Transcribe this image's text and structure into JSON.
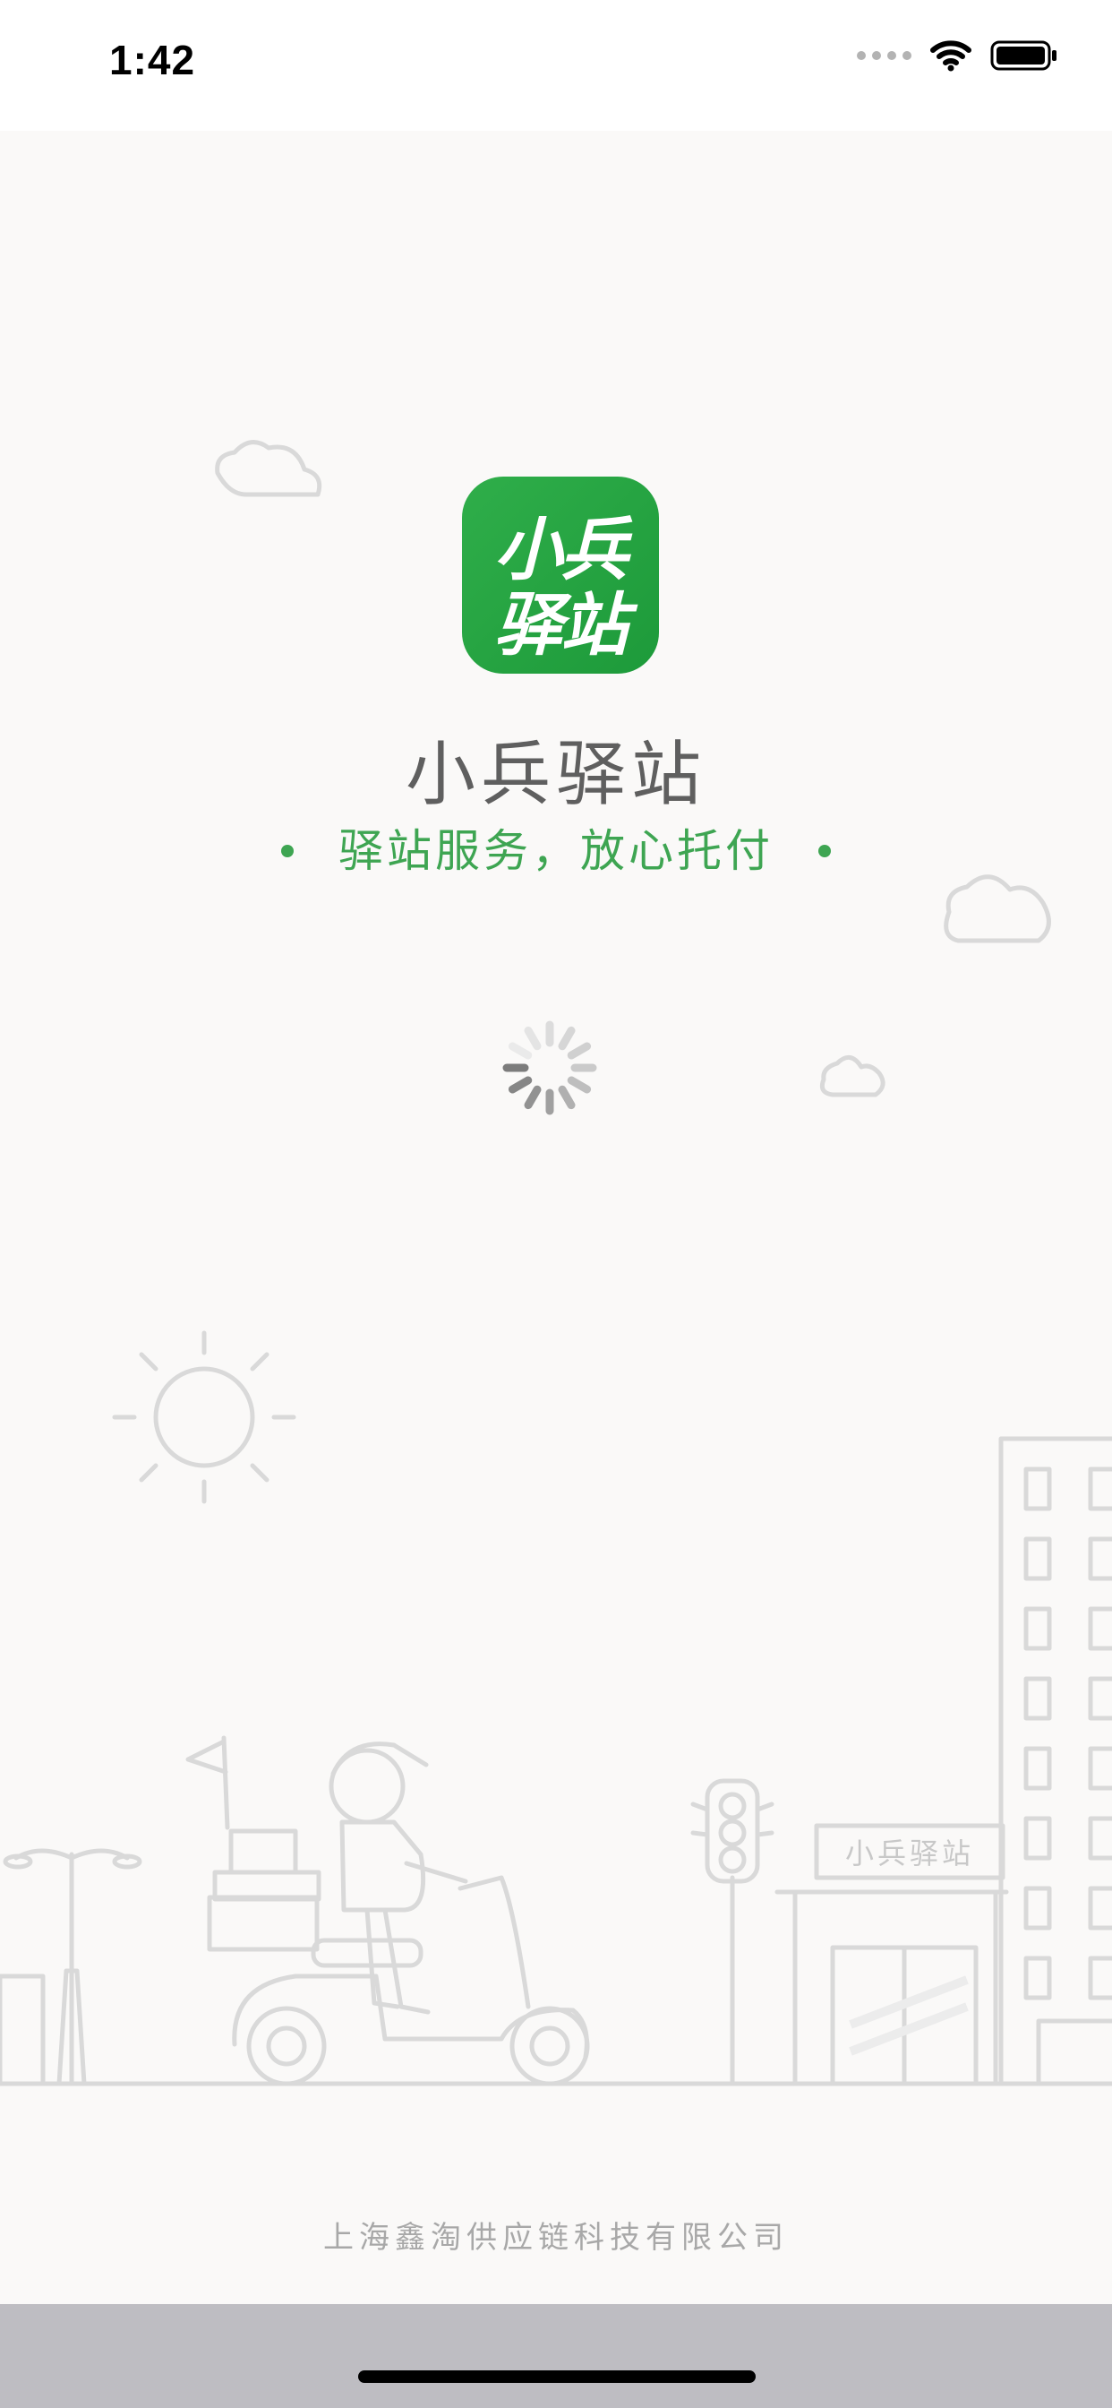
{
  "status_bar": {
    "time": "1:42",
    "icons": [
      "signal-dots-icon",
      "wifi-icon",
      "battery-icon"
    ]
  },
  "splash": {
    "logo_line1": "小兵",
    "logo_line2": "驿站",
    "app_name": "小兵驿站",
    "slogan": "驿站服务，放心托付",
    "store_sign": "小兵驿站",
    "company": "上海鑫淘供应链科技有限公司"
  },
  "colors": {
    "brand_green": "#1d9a3a",
    "slogan_green": "#3ea552",
    "background": "#faf9f8",
    "line_art": "#d9d9d9"
  }
}
